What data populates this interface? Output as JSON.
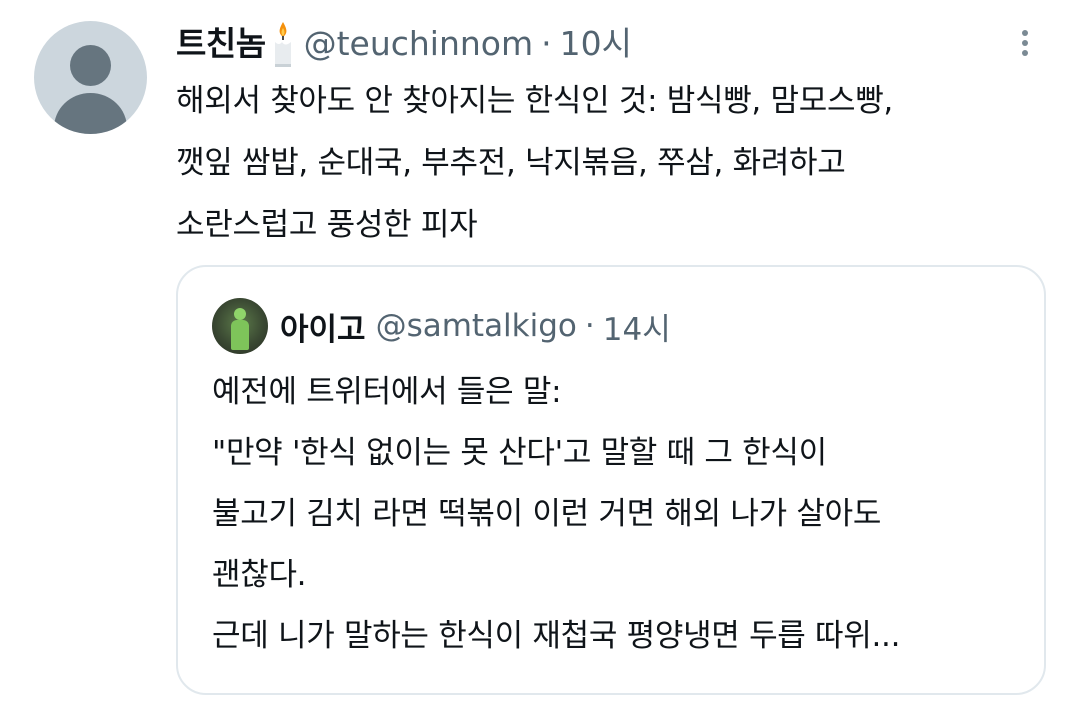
{
  "tweet": {
    "display_name": "트친놈",
    "handle": "@teuchinnom",
    "separator": "·",
    "time": "10시",
    "text_lines": [
      "해외서 찾아도 안 찾아지는 한식인 것: 밤식빵, 맘모스빵,",
      "깻잎 쌈밥, 순대국, 부추전, 낙지볶음, 쭈삼, 화려하고",
      "소란스럽고 풍성한 피자"
    ],
    "icons": {
      "avatar": "default-avatar-icon",
      "name_emoji": "candle-icon",
      "more": "more-vertical-icon"
    }
  },
  "quote": {
    "display_name": "아이고",
    "handle": "@samtalkigo",
    "separator": "·",
    "time": "14시",
    "text_lines": [
      "예전에 트위터에서 들은 말:",
      "\"만약 '한식 없이는 못 산다'고 말할 때 그 한식이",
      "불고기 김치 라면 떡볶이 이런 거면 해외 나가 살아도",
      "괜찮다.",
      "근데 니가 말하는 한식이 재첩국 평양냉면 두릅 따위..."
    ]
  },
  "colors": {
    "text_primary": "#0f1419",
    "text_secondary": "#536471",
    "border": "#e1e8ed",
    "avatar_bg": "#ccd6dd"
  }
}
